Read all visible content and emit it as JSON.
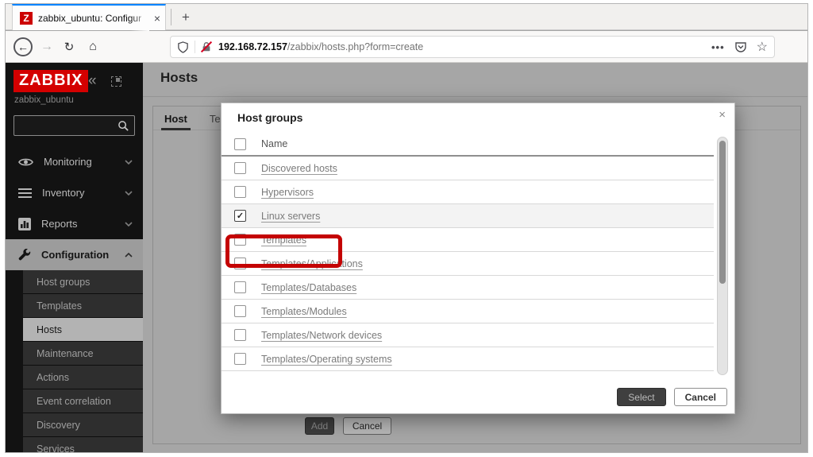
{
  "browser": {
    "tab": {
      "title": "zabbix_ubuntu: Configur",
      "favicon_letter": "Z",
      "close_glyph": "×"
    },
    "new_tab_glyph": "+",
    "nav": {
      "back_glyph": "←",
      "forward_glyph": "→",
      "reload_glyph": "↻",
      "home_glyph": "⌂",
      "more_glyph": "•••",
      "star_glyph": "☆"
    },
    "url": {
      "host": "192.168.72.157",
      "path": "/zabbix/hosts.php?form=create"
    }
  },
  "sidebar": {
    "logo": "ZABBIX",
    "collapse_glyph": "«",
    "server_name": "zabbix_ubuntu",
    "search_value": "",
    "menu": [
      {
        "label": "Monitoring"
      },
      {
        "label": "Inventory"
      },
      {
        "label": "Reports"
      },
      {
        "label": "Configuration"
      }
    ],
    "submenu": [
      {
        "label": "Host groups"
      },
      {
        "label": "Templates"
      },
      {
        "label": "Hosts"
      },
      {
        "label": "Maintenance"
      },
      {
        "label": "Actions"
      },
      {
        "label": "Event correlation"
      },
      {
        "label": "Discovery"
      },
      {
        "label": "Services"
      }
    ]
  },
  "page": {
    "title": "Hosts",
    "tabs": [
      {
        "label": "Host"
      },
      {
        "label": "Templ"
      }
    ],
    "buttons": {
      "add": "Add",
      "cancel": "Cancel"
    }
  },
  "modal": {
    "title": "Host groups",
    "close_glyph": "×",
    "list_header": "Name",
    "groups": [
      "Discovered hosts",
      "Hypervisors",
      "Linux servers",
      "Templates",
      "Templates/Applications",
      "Templates/Databases",
      "Templates/Modules",
      "Templates/Network devices",
      "Templates/Operating systems"
    ],
    "checked_group": "Linux servers",
    "checkmark": "✓",
    "buttons": {
      "select": "Select",
      "cancel": "Cancel"
    }
  },
  "colors": {
    "zabbix_red": "#d40000",
    "annotation_red": "#c40303",
    "tab_accent_blue": "#0a84ff",
    "lock_slash_red": "#d70022"
  }
}
